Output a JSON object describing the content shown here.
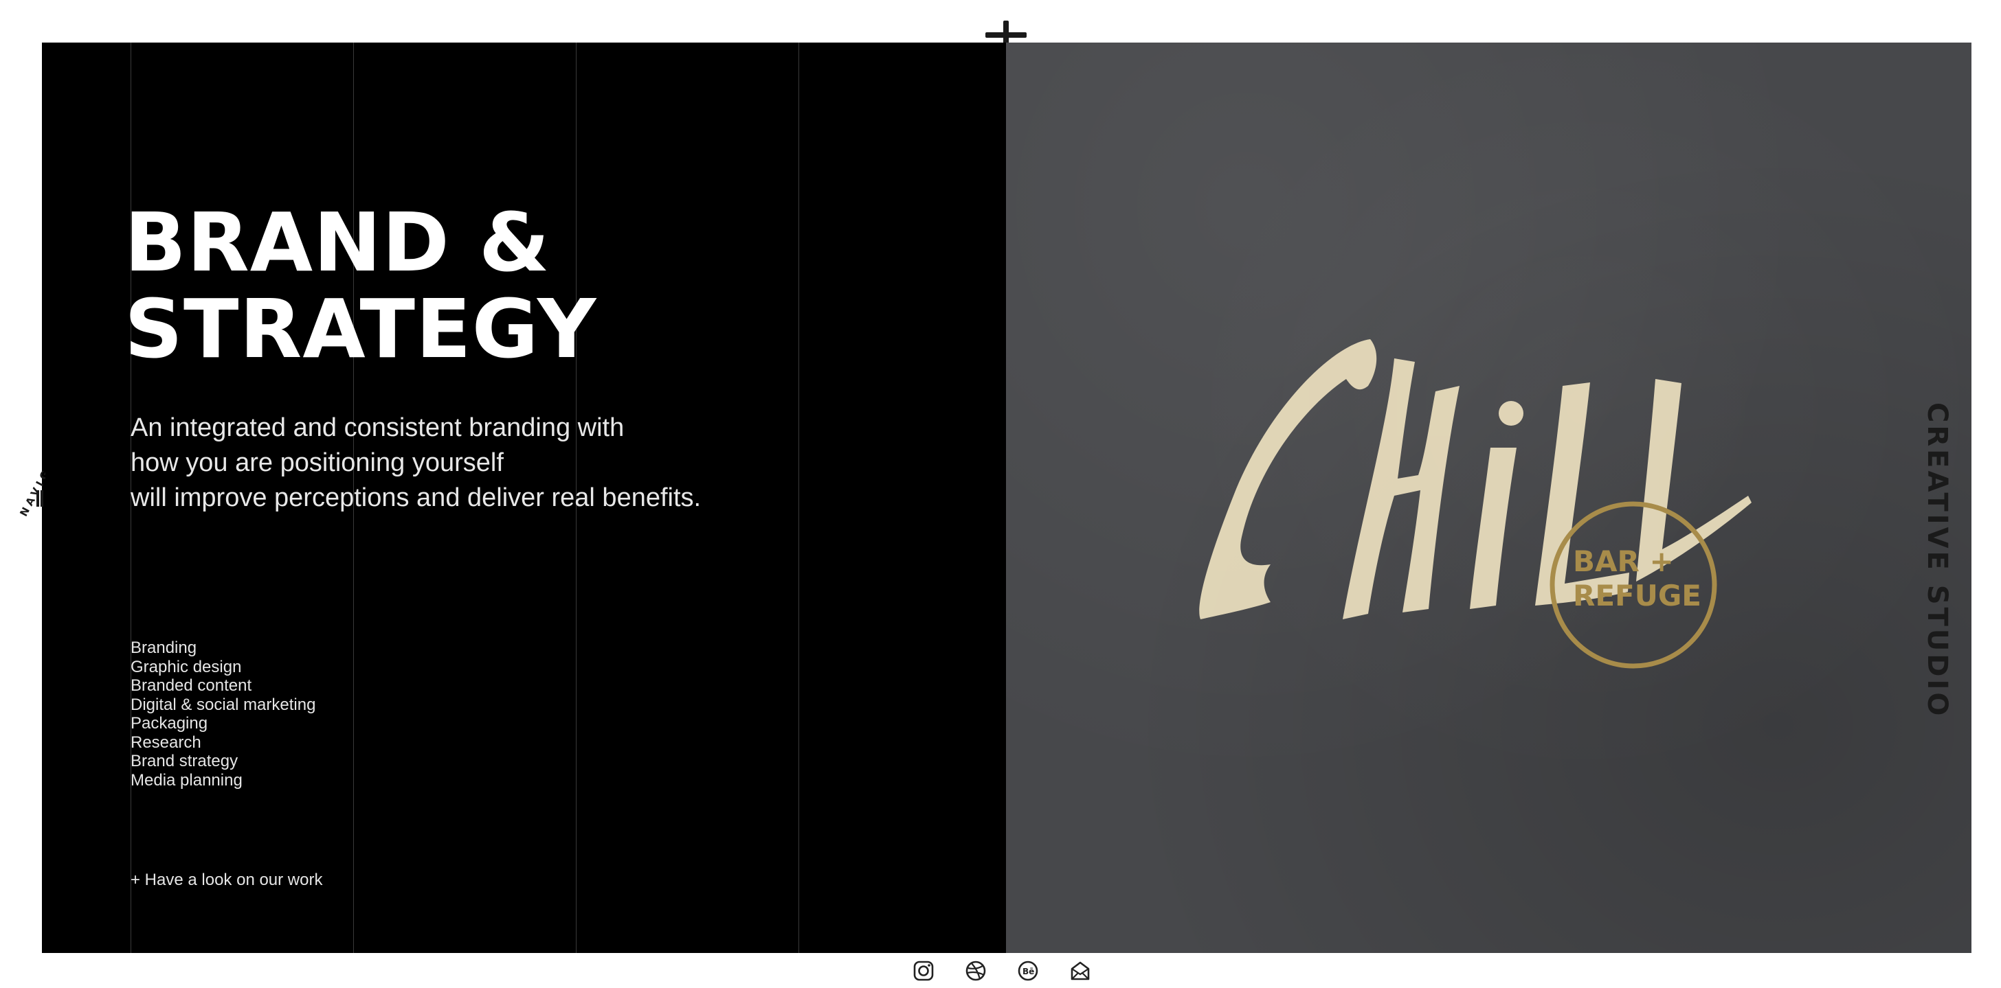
{
  "hero": {
    "title_line1": "BRAND &",
    "title_line2": "STRATEGY",
    "intro_line1": "An integrated and consistent branding with",
    "intro_line2": "how you are positioning yourself",
    "intro_line3": "will improve perceptions and deliver real benefits."
  },
  "services": [
    "Branding",
    "Graphic design",
    "Branded content",
    "Digital & social marketing",
    "Packaging",
    "Research",
    "Brand strategy",
    "Media planning"
  ],
  "cta": {
    "work_link": "+ Have a look on our work"
  },
  "side_label": "CREATIVE STUDIO",
  "nav_label": "NAVIG",
  "artwork": {
    "wordmark": "CHILL",
    "stamp_line1": "BAR +",
    "stamp_line2": "REFUGE"
  },
  "social": [
    "instagram-icon",
    "dribbble-icon",
    "behance-icon",
    "mail-icon"
  ],
  "colors": {
    "panel_dark": "#000000",
    "panel_texture": "#47484b",
    "paint": "#e8dcbc",
    "gold": "#a88c4a"
  }
}
